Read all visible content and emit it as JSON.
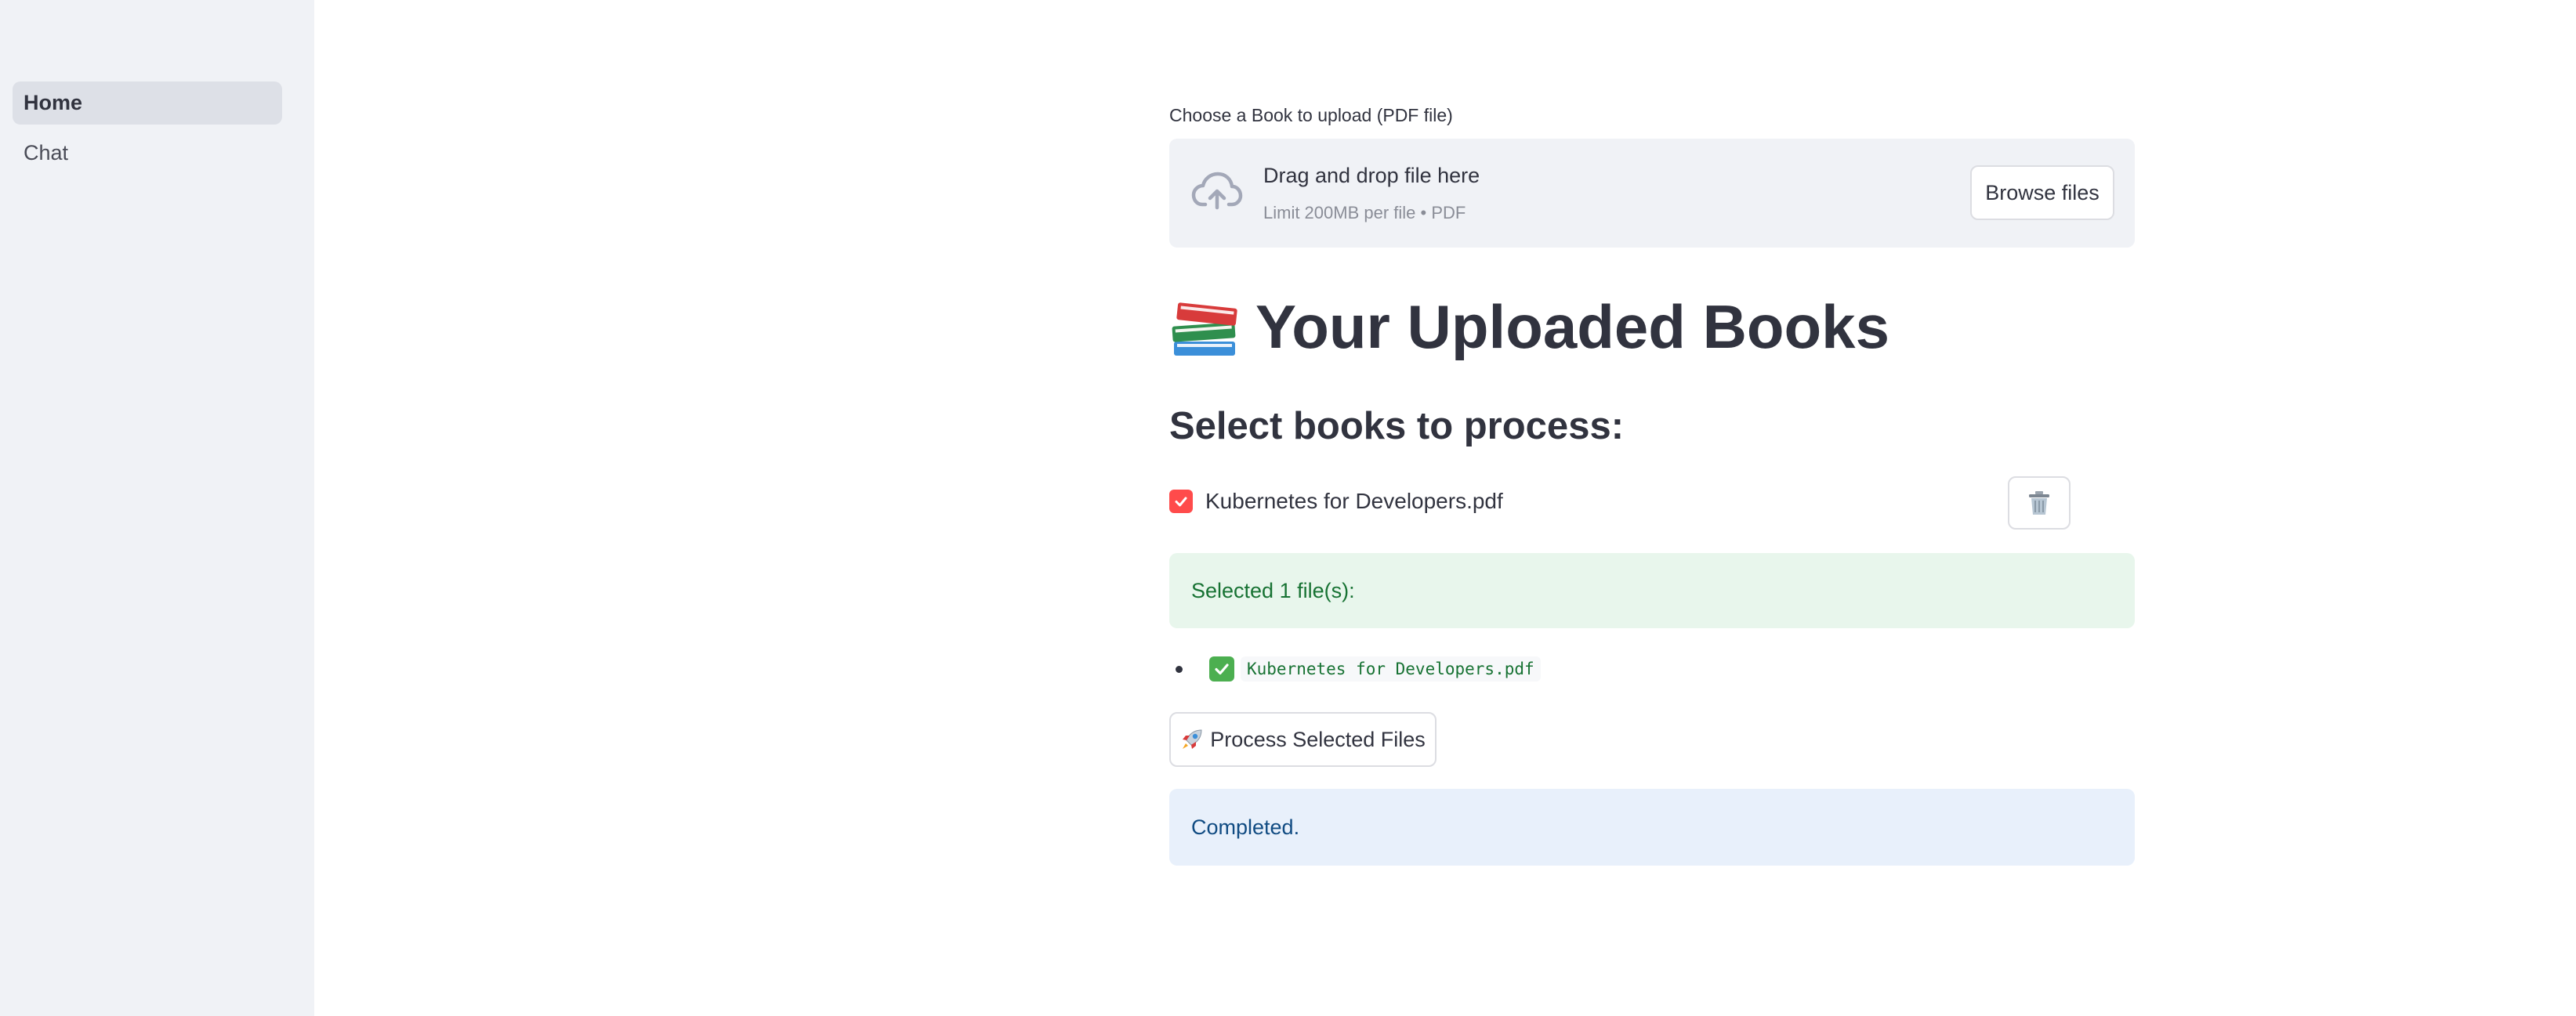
{
  "sidebar": {
    "items": [
      {
        "label": "Home",
        "active": true
      },
      {
        "label": "Chat",
        "active": false
      }
    ]
  },
  "uploader": {
    "label": "Choose a Book to upload (PDF file)",
    "drop_title": "Drag and drop file here",
    "drop_subtitle": "Limit 200MB per file • PDF",
    "browse_label": "Browse files",
    "icon": "cloud-upload-icon"
  },
  "page": {
    "title": "Your Uploaded Books",
    "title_icon": "books-icon",
    "subheading": "Select books to process:"
  },
  "books": [
    {
      "name": "Kubernetes for Developers.pdf",
      "checked": true,
      "delete_icon": "trash-icon"
    }
  ],
  "selection": {
    "message": "Selected 1 file(s):",
    "files": [
      "Kubernetes for Developers.pdf"
    ]
  },
  "process_button": {
    "label": "Process Selected Files",
    "icon": "rocket-icon"
  },
  "status": {
    "message": "Completed."
  },
  "colors": {
    "accent": "#ff4b4b",
    "success_bg": "#e8f6ec",
    "success_text": "#177233",
    "info_bg": "#e8f0fb",
    "info_text": "#104b82",
    "sidebar_bg": "#f0f2f6"
  }
}
